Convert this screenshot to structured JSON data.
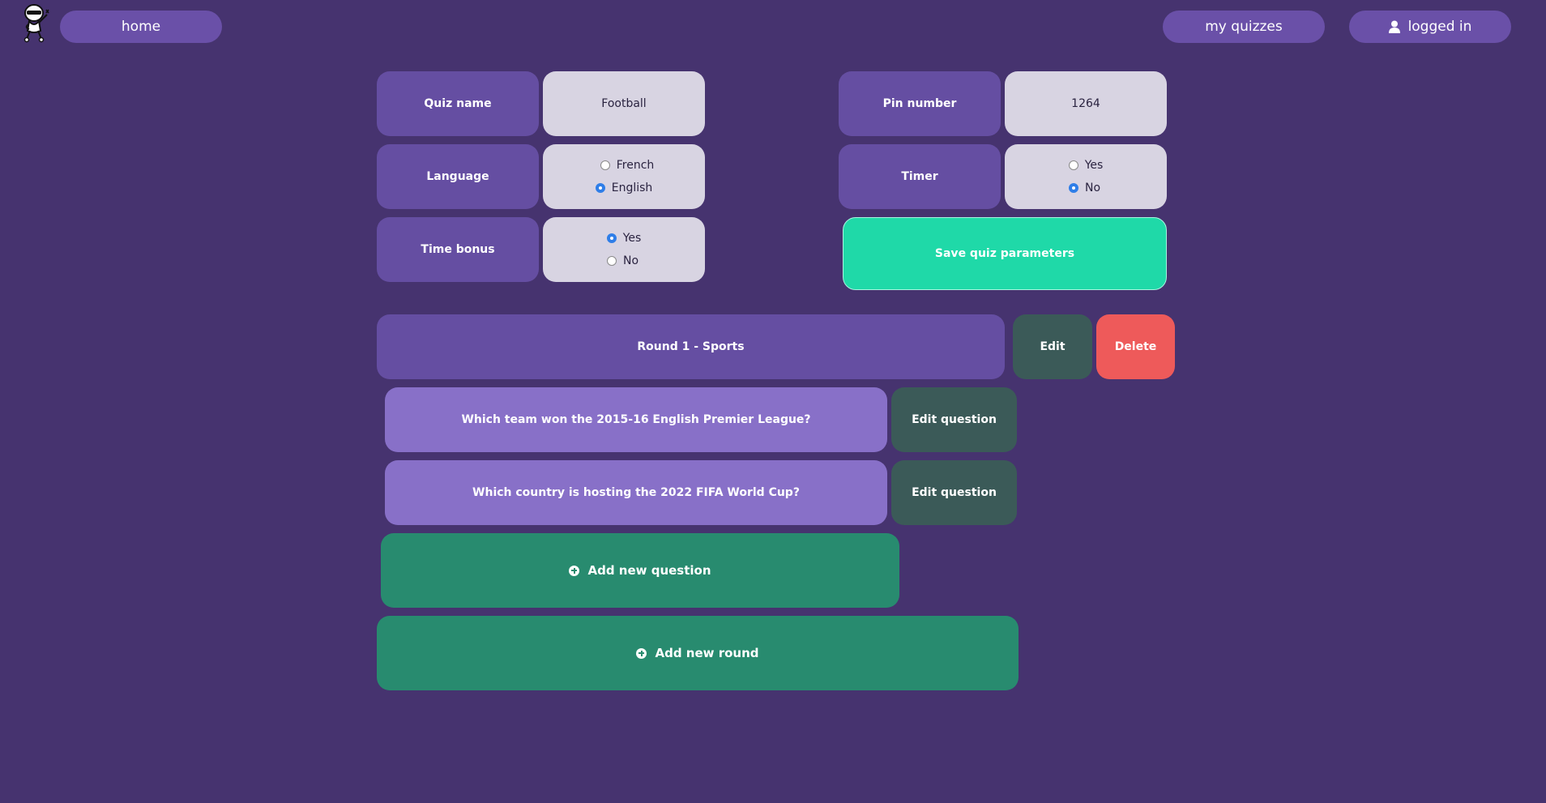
{
  "nav": {
    "home_label": "home",
    "my_quizzes_label": "my quizzes",
    "logged_in_label": "logged in"
  },
  "params": {
    "quiz_name_label": "Quiz name",
    "quiz_name_value": "Football",
    "pin_label": "Pin number",
    "pin_value": "1264",
    "language_label": "Language",
    "language_options": [
      "French",
      "English"
    ],
    "language_selected": "English",
    "timer_label": "Timer",
    "timer_options": [
      "Yes",
      "No"
    ],
    "timer_selected": "No",
    "time_bonus_label": "Time bonus",
    "time_bonus_options": [
      "Yes",
      "No"
    ],
    "time_bonus_selected": "Yes",
    "save_label": "Save quiz parameters"
  },
  "rounds": [
    {
      "title": "Round 1 - Sports",
      "edit_label": "Edit",
      "delete_label": "Delete",
      "questions": [
        {
          "text": "Which team won the 2015-16 English Premier League?",
          "edit_label": "Edit question"
        },
        {
          "text": "Which country is hosting the 2022 FIFA World Cup?",
          "edit_label": "Edit question"
        }
      ],
      "add_question_label": "Add new question"
    }
  ],
  "add_round_label": "Add new round",
  "colors": {
    "background": "#46336f",
    "label_tile": "#654ea2",
    "value_tile": "#d8d4e2",
    "save": "#1fd9a8",
    "edit": "#3b5a58",
    "delete": "#ee5a5a",
    "question": "#8870c8",
    "add": "#288b6f"
  }
}
